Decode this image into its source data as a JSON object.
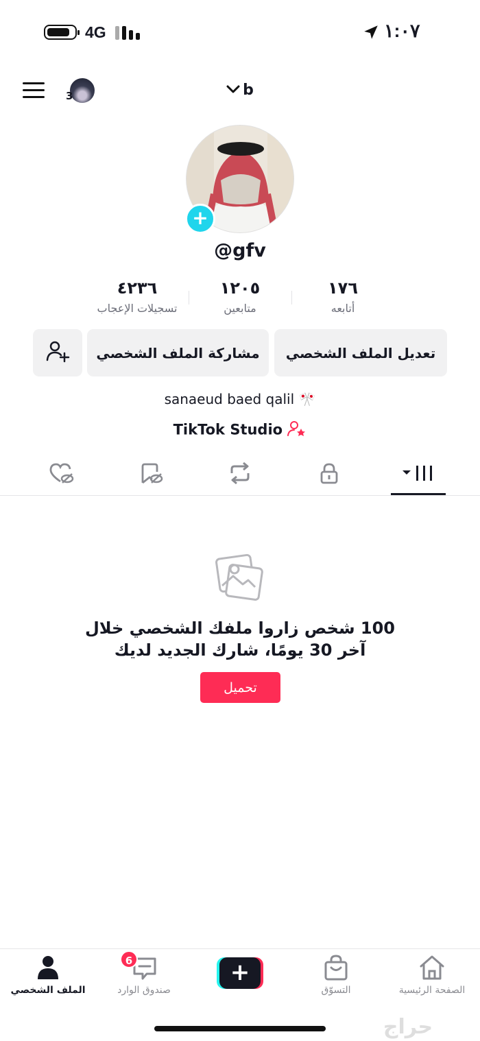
{
  "status_bar": {
    "network": "4G",
    "time": "١:٠٧"
  },
  "header": {
    "username": "b",
    "mini_avatar_badge": "3"
  },
  "profile": {
    "handle": "@gfv",
    "stats": [
      {
        "value": "١٧٦",
        "label": "أتابعه"
      },
      {
        "value": "١٢٠٥",
        "label": "متابعين"
      },
      {
        "value": "٤٢٣٦",
        "label": "تسجيلات الإعجاب"
      }
    ],
    "edit_label": "تعديل الملف الشخصي",
    "share_label": "مشاركة الملف الشخصي",
    "bio": "sanaeud baed qalil 🎌",
    "studio_label": "TikTok Studio"
  },
  "tabs": [
    {
      "name": "videos",
      "icon": "grid-icon",
      "active": true
    },
    {
      "name": "private",
      "icon": "lock-icon",
      "active": false
    },
    {
      "name": "reposts",
      "icon": "repost-icon",
      "active": false
    },
    {
      "name": "favorites",
      "icon": "bookmark-hidden-icon",
      "active": false
    },
    {
      "name": "liked",
      "icon": "heart-hidden-icon",
      "active": false
    }
  ],
  "empty_state": {
    "message": "100 شخص زاروا ملفك الشخصي خلال آخر 30 يومًا، شارك الجديد لديك",
    "upload_label": "تحميل"
  },
  "bottom_nav": {
    "home": "الصفحة الرئيسية",
    "shop": "التسوّق",
    "inbox": "صندوق الوارد",
    "inbox_badge": "6",
    "profile": "الملف الشخصي"
  },
  "watermark": "حراج",
  "colors": {
    "accent": "#fe2c55",
    "cyan": "#25f4ee",
    "add_avatar": "#20d5ec",
    "button_bg": "#f1f1f2",
    "text": "#161823"
  }
}
